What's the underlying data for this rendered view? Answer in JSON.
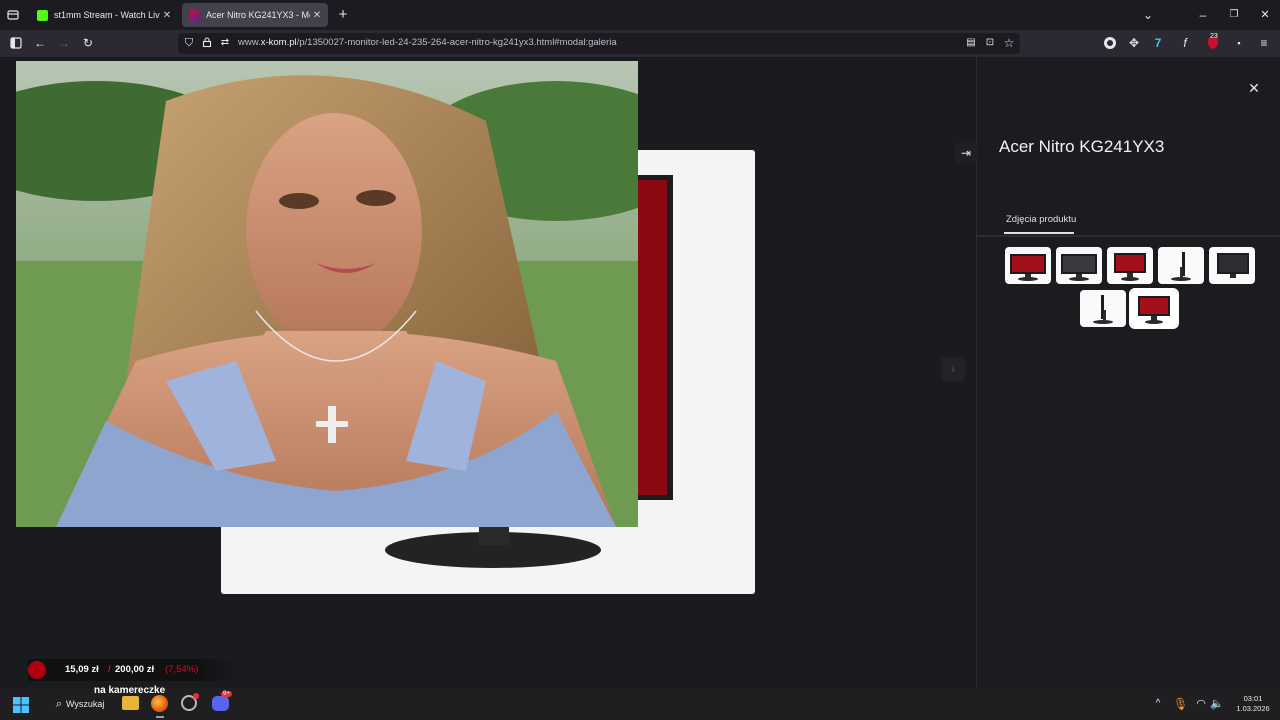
{
  "browser": {
    "tabs": [
      {
        "label": "st1mm Stream - Watch Live on",
        "active": false,
        "favicon_color": "#53fc18"
      },
      {
        "label": "Acer Nitro KG241YX3 - Monito",
        "active": true,
        "favicon_color": "#5b1ea8"
      }
    ],
    "url_prefix": "www.",
    "url_domain": "x-kom.pl",
    "url_path": "/p/1350027-monitor-led-24-235-264-acer-nitro-kg241yx3.html#modal:galeria",
    "extension_badge": "23"
  },
  "gallery": {
    "product_title": "Acer Nitro KG241YX3",
    "tab_label": "Zdjęcia produktu",
    "thumbnails": [
      {
        "type": "monitor-red",
        "selected": false
      },
      {
        "type": "monitor-dark",
        "selected": false
      },
      {
        "type": "monitor-red",
        "selected": false
      },
      {
        "type": "monitor-side",
        "selected": false
      },
      {
        "type": "monitor-dark",
        "selected": false
      },
      {
        "type": "monitor-side",
        "selected": false
      },
      {
        "type": "monitor-red",
        "selected": true
      }
    ]
  },
  "stream_overlay": {
    "amount": "15,09 zł",
    "goal": "200,00 zł",
    "percent": "(7,54%)",
    "caption": "na kamereczke"
  },
  "taskbar": {
    "search_label": "Wyszukaj",
    "time": "03:01",
    "date": "1.03.2026",
    "discord_badge": "9+"
  },
  "colors": {
    "accent_red": "#c8102e",
    "panel_bg": "#1b1c20"
  }
}
